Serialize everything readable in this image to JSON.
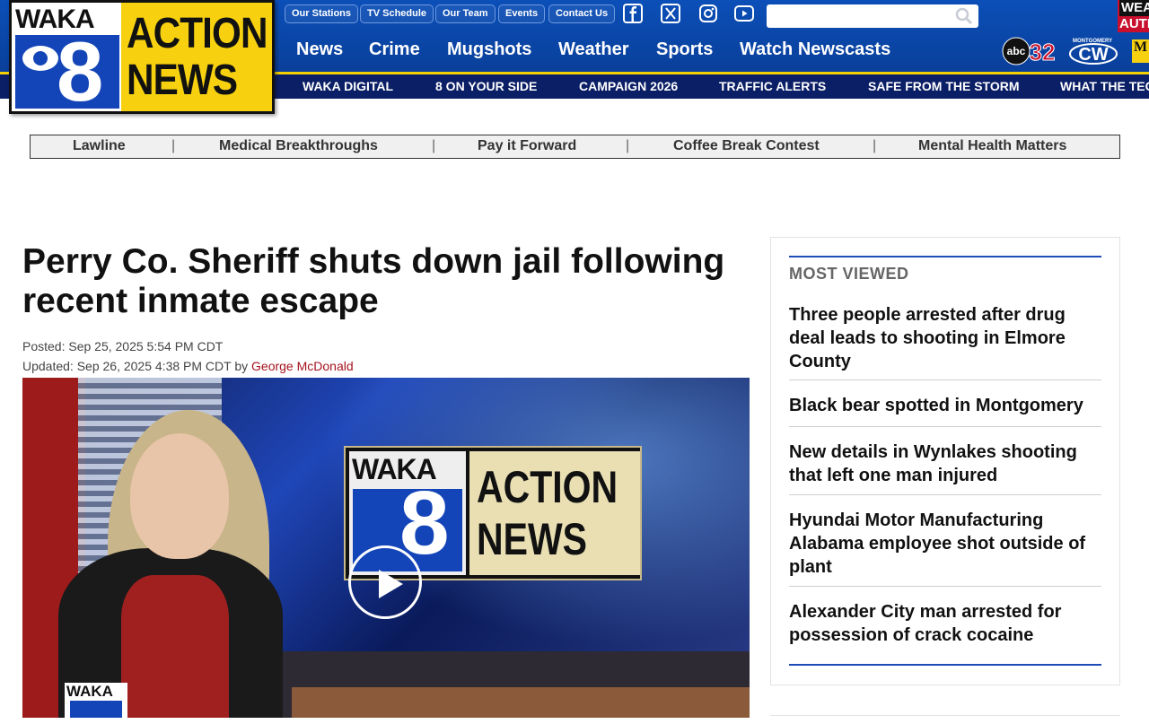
{
  "logo": {
    "waka": "WAKA",
    "eight": "8",
    "line1": "ACTION",
    "line2": "NEWS"
  },
  "utility_links": [
    "Our Stations",
    "TV Schedule",
    "Our Team",
    "Events",
    "Contact Us"
  ],
  "social_icons": [
    "facebook-icon",
    "x-icon",
    "instagram-icon",
    "youtube-icon"
  ],
  "search": {
    "placeholder": ""
  },
  "main_nav": [
    "News",
    "Crime",
    "Mugshots",
    "Weather",
    "Sports",
    "Watch Newscasts"
  ],
  "sub_nav": [
    "WAKA DIGITAL",
    "8 ON YOUR SIDE",
    "CAMPAIGN 2026",
    "TRAFFIC ALERTS",
    "SAFE FROM THE STORM",
    "WHAT THE TECH"
  ],
  "affiliates": {
    "abc": "abc",
    "abc_num": "32",
    "cw_top": "MONTGOMERY",
    "cw": "CW",
    "weather_1": "WEA",
    "weather_2": "AUTH",
    "edge": "M"
  },
  "sections": [
    "Lawline",
    "Medical Breakthroughs",
    "Pay it Forward",
    "Coffee Break Contest",
    "Mental Health Matters"
  ],
  "article": {
    "headline": "Perry Co. Sheriff shuts down jail following recent inmate escape",
    "posted": "Posted: Sep 25, 2025 5:54 PM CDT",
    "updated_prefix": "Updated: Sep 26, 2025 4:38 PM CDT by ",
    "author": "George McDonald"
  },
  "video": {
    "screen_waka": "WAKA",
    "screen_8": "8",
    "screen_line1": "ACTION",
    "screen_line2": "NEWS",
    "bug": "WAKA"
  },
  "most_viewed": {
    "title": "MOST VIEWED",
    "items": [
      "Three people arrested after drug deal leads to shooting in Elmore County",
      "Black bear spotted in Montgomery",
      "New details in Wynlakes shooting that left one man injured",
      "Hyundai Motor Manufacturing Alabama employee shot outside of plant",
      "Alexander City man arrested for possession of crack cocaine"
    ]
  },
  "colors": {
    "brand_blue": "#0b4fb8",
    "brand_navy": "#0b1f66",
    "brand_gold": "#f5d000",
    "author_red": "#a5121c"
  }
}
